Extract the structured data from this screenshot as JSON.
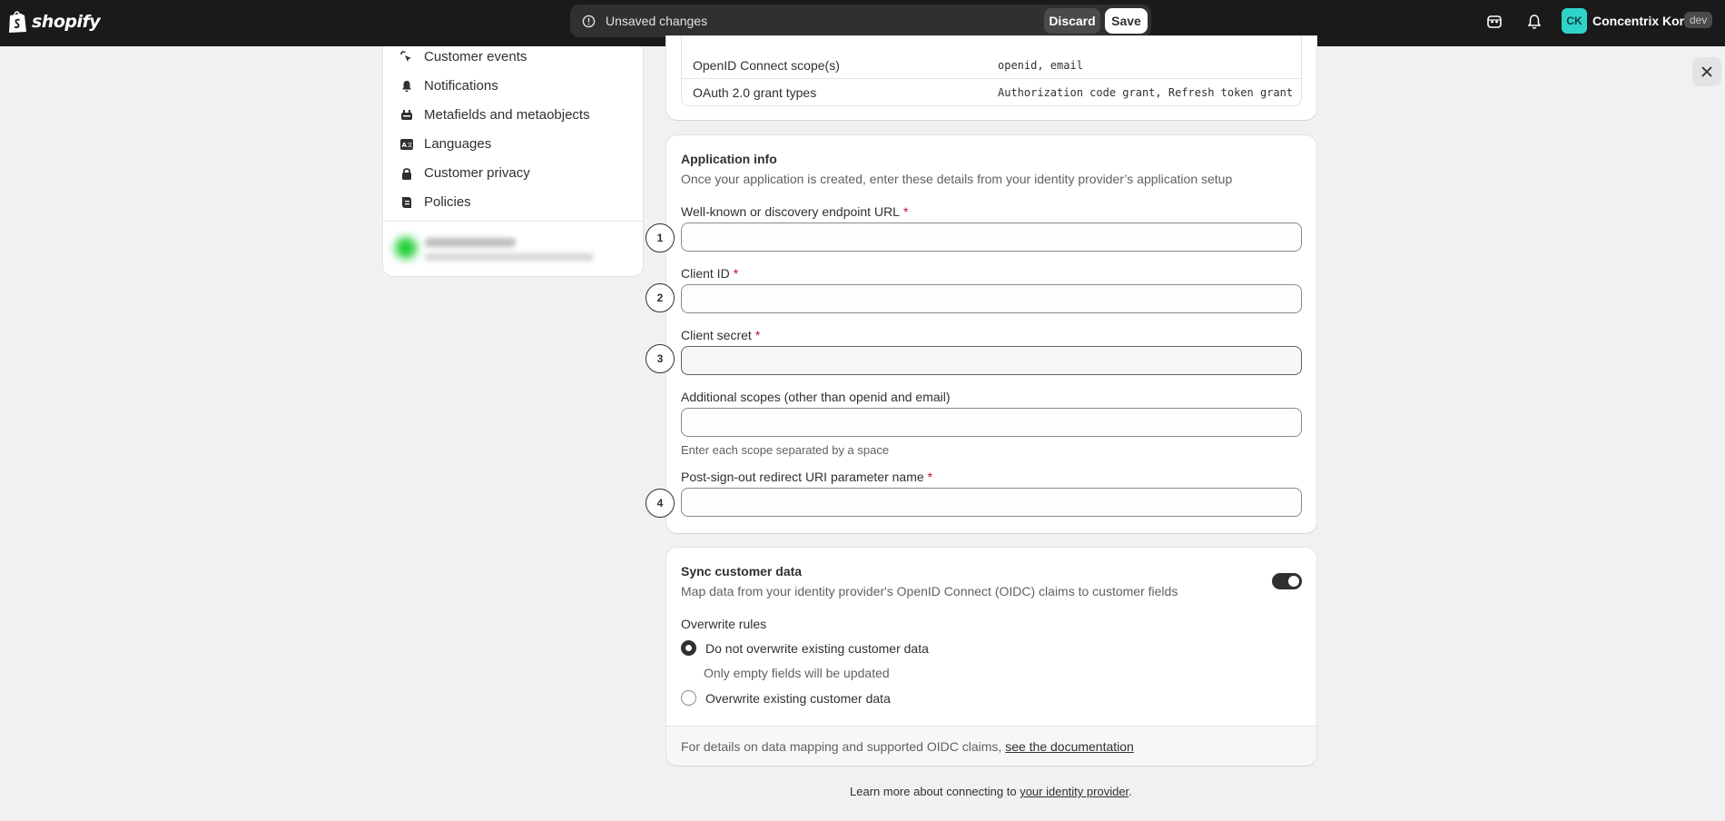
{
  "topbar": {
    "brand": "shopify",
    "unsaved_text": "Unsaved changes",
    "discard_label": "Discard",
    "save_label": "Save",
    "avatar_initials": "CK",
    "store_name": "Concentrix Korea",
    "store_badge": "dev",
    "icons": [
      "shopify-bag-icon",
      "info-icon",
      "sidekick-icon",
      "bell-icon"
    ]
  },
  "sidebar": {
    "items": [
      {
        "label": "Customer events",
        "icon": "cursor-click-icon"
      },
      {
        "label": "Notifications",
        "icon": "bell-icon"
      },
      {
        "label": "Metafields and metaobjects",
        "icon": "database-icon"
      },
      {
        "label": "Languages",
        "icon": "translate-icon"
      },
      {
        "label": "Customer privacy",
        "icon": "lock-icon"
      },
      {
        "label": "Policies",
        "icon": "clipboard-icon"
      }
    ]
  },
  "config_table": {
    "rows": [
      {
        "key": "OpenID Connect scope(s)",
        "value": "openid, email"
      },
      {
        "key": "OAuth 2.0 grant types",
        "value": "Authorization code grant, Refresh token grant"
      }
    ]
  },
  "app_info": {
    "title": "Application info",
    "subtitle": "Once your application is created, enter these details from your identity provider’s application setup",
    "fields": [
      {
        "label": "Well-known or discovery endpoint URL",
        "required": "*",
        "value": "",
        "step": "1"
      },
      {
        "label": "Client ID",
        "required": "*",
        "value": "",
        "step": "2"
      },
      {
        "label": "Client secret",
        "required": "*",
        "value": "",
        "step": "3"
      },
      {
        "label": "Additional scopes (other than openid and email)",
        "value": "",
        "help": "Enter each scope separated by a space"
      },
      {
        "label": "Post-sign-out redirect URI parameter name",
        "required": "*",
        "value": "",
        "step": "4"
      }
    ]
  },
  "sync": {
    "title": "Sync customer data",
    "subtitle": "Map data from your identity provider's OpenID Connect (OIDC) claims to customer fields",
    "toggle_on": true,
    "overwrite_label": "Overwrite rules",
    "options": [
      {
        "label": "Do not overwrite existing customer data",
        "help": "Only empty fields will be updated",
        "checked": true
      },
      {
        "label": "Overwrite existing customer data",
        "checked": false
      }
    ],
    "footer_text": "For details on data mapping and supported OIDC claims,",
    "footer_link": "see the documentation"
  },
  "bottom": {
    "text": "Learn more about connecting to",
    "link": "your identity provider",
    "end": "."
  },
  "colors": {
    "topbar_bg": "#1a1a1a",
    "page_bg": "#f1f1f1",
    "required": "#c70a24",
    "avatar": "#2fd3c8"
  }
}
